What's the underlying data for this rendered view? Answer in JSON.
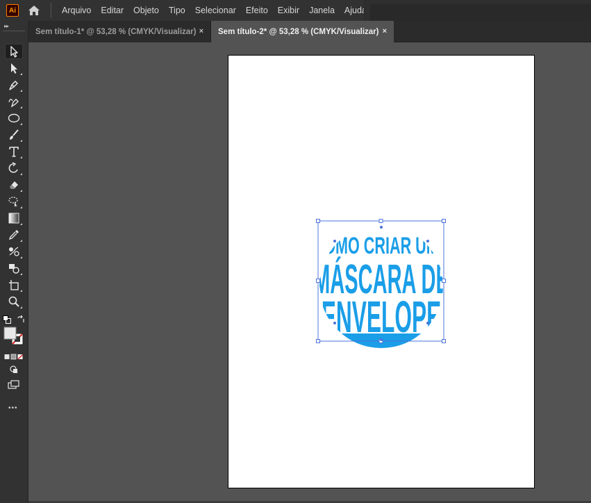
{
  "app": {
    "logo_text": "Ai"
  },
  "menu": {
    "items": [
      "Arquivo",
      "Editar",
      "Objeto",
      "Tipo",
      "Selecionar",
      "Efeito",
      "Exibir",
      "Janela",
      "Ajuda"
    ]
  },
  "tabs": [
    {
      "label": "Sem título-1* @ 53,28 % (CMYK/Visualizar)",
      "close": "×"
    },
    {
      "label": "Sem título-2* @ 53,28 % (CMYK/Visualizar)",
      "close": "×"
    }
  ],
  "toolbar": {
    "grip": "▸▸",
    "more_label": "•••",
    "tools": [
      {
        "name": "selection-tool-icon",
        "active": true
      },
      {
        "name": "direct-selection-tool-icon"
      },
      {
        "name": "pen-tool-icon"
      },
      {
        "name": "curvature-tool-icon"
      },
      {
        "name": "ellipse-tool-icon"
      },
      {
        "name": "paintbrush-tool-icon"
      },
      {
        "name": "type-tool-icon"
      },
      {
        "name": "rotate-tool-icon"
      },
      {
        "name": "eraser-tool-icon"
      },
      {
        "name": "lasso-tool-icon"
      },
      {
        "name": "gradient-tool-icon"
      },
      {
        "name": "eyedropper-tool-icon"
      },
      {
        "name": "blend-tool-icon"
      },
      {
        "name": "shape-builder-tool-icon"
      },
      {
        "name": "artboard-tool-icon"
      },
      {
        "name": "zoom-tool-icon"
      }
    ]
  },
  "artwork": {
    "line1": "COMO CRIAR UMA",
    "line2": "MÁSCARA DE",
    "line3": "ENVELOPE",
    "text_color": "#1a9ee8",
    "selection_color": "#4a73d9"
  },
  "colors": {
    "accent": "#4a73d9",
    "artwork": "#1a9ee8"
  }
}
